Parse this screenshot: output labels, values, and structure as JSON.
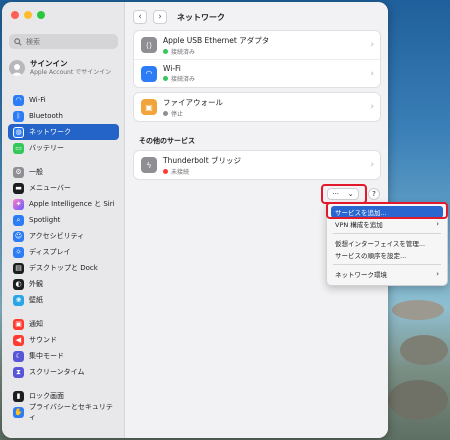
{
  "sidebar": {
    "search_placeholder": "検索",
    "account_title": "サインイン",
    "account_subtitle": "Apple Account でサインイン",
    "items": [
      {
        "label": "Wi-Fi",
        "icon": "wifi-icon",
        "color": "#2c7cf6"
      },
      {
        "label": "Bluetooth",
        "icon": "bluetooth-icon",
        "color": "#2c7cf6"
      },
      {
        "label": "ネットワーク",
        "icon": "globe-icon",
        "color": "#2c7cf6",
        "active": true
      },
      {
        "label": "バッテリー",
        "icon": "battery-icon",
        "color": "#34c759"
      },
      {
        "label": "一般",
        "icon": "gear-icon",
        "color": "#8e8e93"
      },
      {
        "label": "メニューバー",
        "icon": "menubar-icon",
        "color": "#1d1d1f"
      },
      {
        "label": "Apple Intelligence と Siri",
        "icon": "siri-icon",
        "color": "#b55cf0"
      },
      {
        "label": "Spotlight",
        "icon": "spotlight-icon",
        "color": "#2c7cf6"
      },
      {
        "label": "アクセシビリティ",
        "icon": "accessibility-icon",
        "color": "#2c7cf6"
      },
      {
        "label": "ディスプレイ",
        "icon": "display-icon",
        "color": "#2c7cf6"
      },
      {
        "label": "デスクトップと Dock",
        "icon": "dock-icon",
        "color": "#1d1d1f"
      },
      {
        "label": "外観",
        "icon": "appearance-icon",
        "color": "#1d1d1f"
      },
      {
        "label": "壁紙",
        "icon": "wallpaper-icon",
        "color": "#28a6e6"
      },
      {
        "label": "通知",
        "icon": "bell-icon",
        "color": "#ff3b30"
      },
      {
        "label": "サウンド",
        "icon": "speaker-icon",
        "color": "#ff3b30"
      },
      {
        "label": "集中モード",
        "icon": "moon-icon",
        "color": "#5856d6"
      },
      {
        "label": "スクリーンタイム",
        "icon": "hourglass-icon",
        "color": "#5856d6"
      },
      {
        "label": "ロック画面",
        "icon": "lock-icon",
        "color": "#1d1d1f"
      },
      {
        "label": "プライバシーとセキュリティ",
        "icon": "hand-icon",
        "color": "#2c7cf6"
      }
    ]
  },
  "toolbar": {
    "title": "ネットワーク",
    "back": "‹",
    "forward": "›"
  },
  "services": [
    {
      "name": "Apple USB Ethernet アダプタ",
      "status": "接続済み",
      "status_color": "#34c759",
      "icon": "ethernet-icon",
      "icon_color": "#8e8e93"
    },
    {
      "name": "Wi-Fi",
      "status": "接続済み",
      "status_color": "#34c759",
      "icon": "wifi-icon",
      "icon_color": "#2c7cf6"
    }
  ],
  "firewall": {
    "name": "ファイアウォール",
    "status": "停止",
    "status_color": "#8e8e93",
    "icon_color": "#f2a33a"
  },
  "other_services": {
    "title": "その他のサービス",
    "items": [
      {
        "name": "Thunderbolt ブリッジ",
        "status": "未接続",
        "status_color": "#ff3b30",
        "icon_color": "#8e8e93"
      }
    ]
  },
  "action_button": {
    "label": "···",
    "chevron": "⌄"
  },
  "help_label": "?",
  "menu": {
    "items": [
      "サービスを追加...",
      "VPN 構成を追加",
      "仮想インターフェイスを管理...",
      "サービスの順序を設定...",
      "ネットワーク環境"
    ]
  }
}
